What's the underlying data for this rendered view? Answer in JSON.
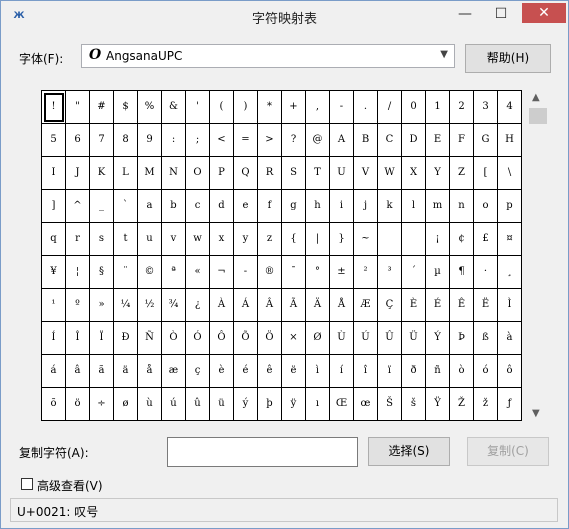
{
  "window": {
    "title": "字符映射表",
    "minimize": "—",
    "maximize": "☐",
    "close": "✕"
  },
  "font": {
    "label": "字体(F):",
    "value": "AngsanaUPC",
    "icon_glyph": "O",
    "icon": "opentype-icon"
  },
  "help_button": "帮助(H)",
  "characters": [
    "!",
    "\"",
    "#",
    "$",
    "%",
    "&",
    "'",
    "(",
    ")",
    "*",
    "+",
    ",",
    "-",
    ".",
    "/",
    "0",
    "1",
    "2",
    "3",
    "4",
    "5",
    "6",
    "7",
    "8",
    "9",
    ":",
    ";",
    "<",
    "=",
    ">",
    "?",
    "@",
    "A",
    "B",
    "C",
    "D",
    "E",
    "F",
    "G",
    "H",
    "I",
    "J",
    "K",
    "L",
    "M",
    "N",
    "O",
    "P",
    "Q",
    "R",
    "S",
    "T",
    "U",
    "V",
    "W",
    "X",
    "Y",
    "Z",
    "[",
    "\\",
    "]",
    "^",
    "_",
    "`",
    "a",
    "b",
    "c",
    "d",
    "e",
    "f",
    "g",
    "h",
    "i",
    "j",
    "k",
    "l",
    "m",
    "n",
    "o",
    "p",
    "q",
    "r",
    "s",
    "t",
    "u",
    "v",
    "w",
    "x",
    "y",
    "z",
    "{",
    "|",
    "}",
    "~",
    "",
    "",
    "¡",
    "¢",
    "£",
    "¤",
    "¥",
    "¦",
    "§",
    "¨",
    "©",
    "ª",
    "«",
    "¬",
    "-",
    "®",
    "¯",
    "°",
    "±",
    "²",
    "³",
    "´",
    "µ",
    "¶",
    "·",
    "¸",
    "¹",
    "º",
    "»",
    "¼",
    "½",
    "¾",
    "¿",
    "À",
    "Á",
    "Â",
    "Ã",
    "Ä",
    "Å",
    "Æ",
    "Ç",
    "È",
    "É",
    "Ê",
    "Ë",
    "Ì",
    "Í",
    "Î",
    "Ï",
    "Ð",
    "Ñ",
    "Ò",
    "Ó",
    "Ô",
    "Õ",
    "Ö",
    "×",
    "Ø",
    "Ù",
    "Ú",
    "Û",
    "Ü",
    "Ý",
    "Þ",
    "ß",
    "à",
    "á",
    "â",
    "ã",
    "ä",
    "å",
    "æ",
    "ç",
    "è",
    "é",
    "ê",
    "ë",
    "ì",
    "í",
    "î",
    "ï",
    "ð",
    "ñ",
    "ò",
    "ó",
    "ô",
    "õ",
    "ö",
    "÷",
    "ø",
    "ù",
    "ú",
    "û",
    "ü",
    "ý",
    "þ",
    "ÿ",
    "ı",
    "Œ",
    "œ",
    "Š",
    "š",
    "Ÿ",
    "Ž",
    "ž",
    "ƒ"
  ],
  "selected_char": "!",
  "scroll": {
    "up": "▲",
    "down": "▼"
  },
  "copy": {
    "label": "复制字符(A):",
    "value": "",
    "select_button": "选择(S)",
    "copy_button": "复制(C)"
  },
  "advanced": {
    "label": "高级查看(V)",
    "checked": false
  },
  "status": "U+0021: 叹号"
}
